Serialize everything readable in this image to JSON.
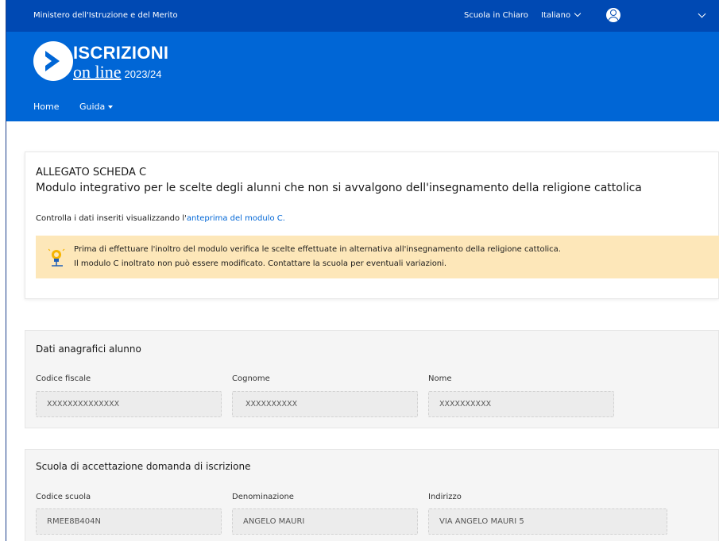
{
  "topbar": {
    "ministry": "Ministero dell'Istruzione e del Merito",
    "scuola_in_chiaro": "Scuola in Chiaro",
    "language": "Italiano"
  },
  "brand": {
    "title": "ISCRIZIONI",
    "subtitle": "on line",
    "year": "2023/24"
  },
  "nav": {
    "home": "Home",
    "guida": "Guida"
  },
  "intro": {
    "heading": "ALLEGATO SCHEDA C",
    "subheading": "Modulo integrativo per le scelte degli alunni che non si avvalgono dell'insegnamento della religione cattolica",
    "controlla_text": "Controlla i dati inseriti visualizzando l'",
    "preview_link": "anteprima del modulo C.",
    "alert_line1": "Prima di effettuare l'inoltro del modulo verifica le scelte effettuate in alternativa all'insegnamento della religione cattolica.",
    "alert_line2": "Il modulo C inoltrato non può essere modificato. Contattare la scuola per eventuali variazioni."
  },
  "student": {
    "title": "Dati anagrafici alunno",
    "codice_fiscale_label": "Codice fiscale",
    "codice_fiscale_value": "XXXXXXXXXXXXXX",
    "cognome_label": "Cognome",
    "cognome_value": "XXXXXXXXXX",
    "nome_label": "Nome",
    "nome_value": "XXXXXXXXXX"
  },
  "school": {
    "title": "Scuola di accettazione domanda di iscrizione",
    "codice_label": "Codice scuola",
    "codice_value": "RMEE8B404N",
    "denominazione_label": "Denominazione",
    "denominazione_value": "ANGELO MAURI",
    "indirizzo_label": "Indirizzo",
    "indirizzo_value": "VIA ANGELO MAURI 5"
  },
  "colors": {
    "topbar_bg": "#0049b3",
    "header_bg": "#0066d6",
    "alert_bg": "#fde7b9",
    "link": "#0066d6"
  }
}
